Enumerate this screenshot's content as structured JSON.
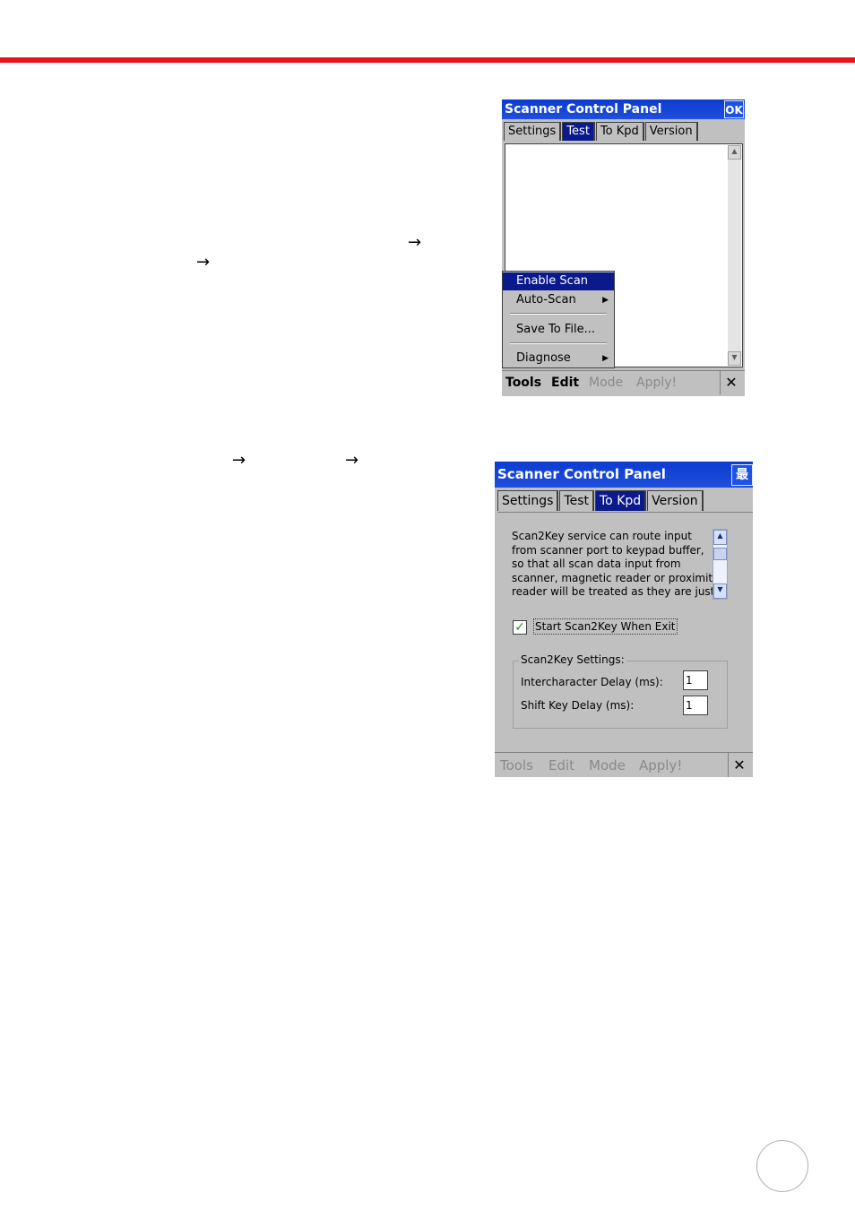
{
  "page": {
    "arrows": [
      "→",
      "→",
      "→",
      "→"
    ]
  },
  "window1": {
    "title": "Scanner Control Panel",
    "title_button": "OK",
    "tabs": [
      "Settings",
      "Test",
      "To Kpd",
      "Version"
    ],
    "active_tab": "Test",
    "popup_menu": {
      "items": [
        "Enable Scan",
        "Auto-Scan",
        "Save To File...",
        "Diagnose"
      ],
      "highlighted": "Enable Scan",
      "submenu_marker": "▶"
    },
    "menubar": {
      "tools": "Tools",
      "edit": "Edit",
      "mode": "Mode",
      "apply": "Apply!",
      "close": "✕"
    }
  },
  "window2": {
    "title": "Scanner Control Panel",
    "title_button": "最",
    "tabs": [
      "Settings",
      "Test",
      "To Kpd",
      "Version"
    ],
    "active_tab": "To Kpd",
    "description": "Scan2Key service can route input\nfrom scanner port to keypad buffer,\nso that all scan data input from\nscanner, magnetic reader or proximity\nreader will be treated as they are just",
    "checkbox_label": "Start Scan2Key When Exit",
    "checkbox_checked": true,
    "checkbox_mark": "✓",
    "settings_group_label": "Scan2Key Settings:",
    "intercharacter_label": "Intercharacter Delay (ms):",
    "intercharacter_value": "1",
    "shift_label": "Shift Key Delay (ms):",
    "shift_value": "1",
    "menubar": {
      "tools": "Tools",
      "edit": "Edit",
      "mode": "Mode",
      "apply": "Apply!",
      "close": "✕"
    }
  },
  "colors": {
    "header_rule": "#e8141c",
    "title_bar": "#1f4fdc",
    "selection": "#0a1a8c",
    "window_face": "#c0c0c0"
  },
  "icons": [
    "arrow-right-icon",
    "submenu-arrow-icon",
    "checkmark-icon",
    "close-icon",
    "scroll-up-icon",
    "scroll-down-icon"
  ]
}
